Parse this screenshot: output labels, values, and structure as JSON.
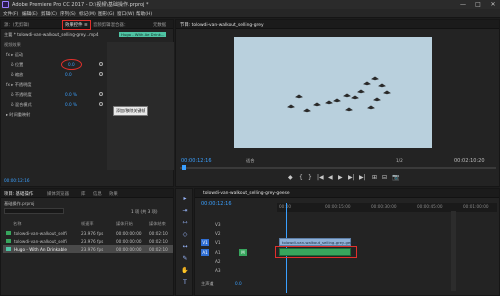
{
  "app": {
    "title": "Adobe Premiere Pro CC 2017 - D:\\视频\\基础操作.prproj *",
    "window_controls": [
      "—",
      "□",
      "✕"
    ]
  },
  "menu": [
    "文件(F)",
    "编辑(E)",
    "剪辑(C)",
    "序列(S)",
    "标记(M)",
    "图形(G)",
    "窗口(W)",
    "帮助(H)"
  ],
  "effects_panel": {
    "tabs": [
      "源：(无剪辑)",
      "效果控件 ≡",
      "音频剪辑混合器：",
      "元数据"
    ],
    "header": "主要 * tolowdi-van-walkout_selling-grey...mp4",
    "sequence_name": "Hugo - With Ae Drink...",
    "section": "视频效果",
    "rows": [
      {
        "label": "fx ▸ 运动",
        "value": ""
      },
      {
        "label": "ö 位置",
        "value": "0.0"
      },
      {
        "label": "ö 缩放",
        "value": "0.0"
      },
      {
        "label": "fx ▸ 不透明度",
        "value": ""
      },
      {
        "label": "ö 不透明度",
        "value": "0.0 %"
      },
      {
        "label": "ö 混合模式",
        "value": "0.0 %"
      },
      {
        "label": "▸ 时间重映射",
        "value": ""
      }
    ],
    "tooltip": "添加/移除关键帧",
    "timecode": "00:00:12:16"
  },
  "program": {
    "tab": "节目: tolowdi-van-walkout_selling-grey",
    "timecode_current": "00:00:12:16",
    "zoom": "适合",
    "fraction": "1/2",
    "timecode_total": "00:02:10:20",
    "transport": [
      "◆",
      "{",
      "}",
      "|◀",
      "◀",
      "▶",
      "▶|",
      "▶|",
      "⊞",
      "⊟",
      "📷"
    ]
  },
  "project": {
    "tabs": [
      "项目: 基础操作",
      "媒体浏览器",
      "库",
      "信息",
      "效果"
    ],
    "search_placeholder": "",
    "item_count": "1 项 (共 3 项)",
    "path": "基础操作.prproj",
    "columns": [
      "名称",
      "帧速率",
      "媒体开始",
      "媒体结束"
    ],
    "rows": [
      {
        "name": "tolowdi-van-walkout_selfi",
        "fps": "23.976 fps",
        "start": "00:00:00:00",
        "end": "00:02:10"
      },
      {
        "name": "tolowdi-van-walkout_selfi",
        "fps": "23.976 fps",
        "start": "00:00:00:00",
        "end": "00:02:10"
      },
      {
        "name": "Hugo - With An Drinkable",
        "fps": "23.976 fps",
        "start": "00:00:00:00",
        "end": "00:02:10"
      }
    ]
  },
  "timeline": {
    "tab": "tolowdi-van-walkout_selling-grey-geese",
    "timecode": "00:00:12:16",
    "ruler": [
      "00:00",
      "00:00:15:00",
      "00:00:30:00",
      "00:00:45:00",
      "00:01:00:00"
    ],
    "tracks": [
      {
        "id": "V3",
        "type": "video"
      },
      {
        "id": "V2",
        "type": "video"
      },
      {
        "id": "V1",
        "type": "video"
      },
      {
        "id": "A1",
        "type": "audio"
      },
      {
        "id": "A2",
        "type": "audio"
      },
      {
        "id": "A3",
        "type": "audio"
      }
    ],
    "clip_v1": "tolowdi-van-walkout_selling-grey-geese",
    "master": "主声道",
    "master_value": "0.0"
  },
  "colors": {
    "accent_blue": "#3aa0ff",
    "highlight_red": "#e0302c",
    "clip_teal": "#4fc4a4",
    "video_clip": "#8fb0d6",
    "audio_clip": "#37a55d"
  }
}
